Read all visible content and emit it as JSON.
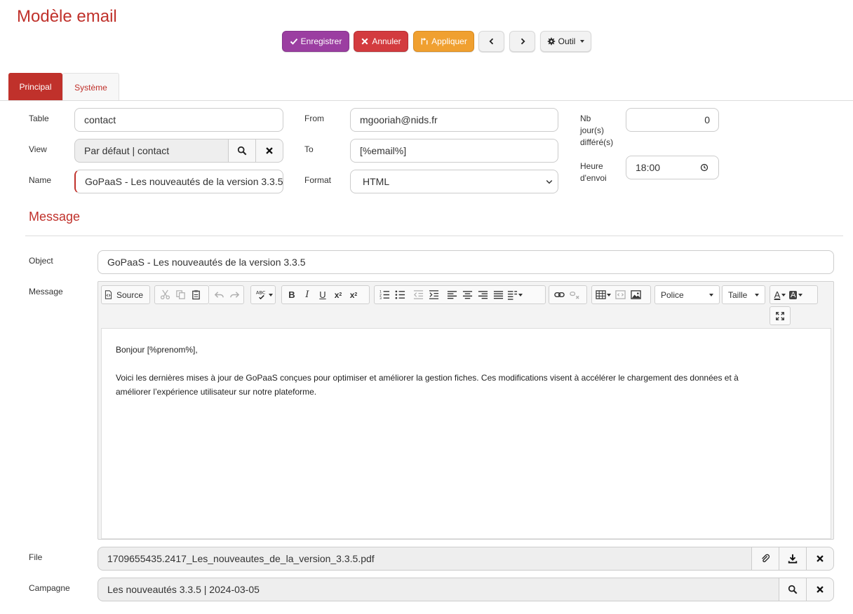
{
  "page": {
    "title": "Modèle email"
  },
  "toolbar": {
    "save_label": "Enregistrer",
    "cancel_label": "Annuler",
    "apply_label": "Appliquer",
    "tool_label": "Outil",
    "colors": {
      "save": "#9b3ea1",
      "cancel": "#d33b3f",
      "apply": "#f0a030"
    }
  },
  "tabs": [
    {
      "label": "Principal",
      "active": true
    },
    {
      "label": "Système",
      "active": false
    }
  ],
  "form": {
    "table": {
      "label": "Table",
      "value": "contact"
    },
    "view": {
      "label": "View",
      "value": "Par défaut | contact"
    },
    "name": {
      "label": "Name",
      "value": "GoPaaS - Les nouveautés de la version 3.3.5"
    },
    "from": {
      "label": "From",
      "value": "mgooriah@nids.fr"
    },
    "to": {
      "label": "To",
      "value": "[%email%]"
    },
    "format": {
      "label": "Format",
      "value": "HTML"
    },
    "nb_jours": {
      "label_line1": "Nb",
      "label_line2": "jour(s)",
      "label_line3": "différé(s)",
      "value": "0"
    },
    "heure": {
      "label_line1": "Heure",
      "label_line2": "d'envoi",
      "value": "18:00"
    }
  },
  "message_section": {
    "title": "Message",
    "object_label": "Object",
    "object_value": "GoPaaS - Les nouveautés de la version 3.3.5",
    "message_label": "Message",
    "editor": {
      "source_label": "Source",
      "font_label": "Police",
      "size_label": "Taille",
      "body_line1": "Bonjour [%prenom%],",
      "body_line2": "Voici les dernières mises à jour de GoPaaS conçues pour optimiser et améliorer la gestion fiches. Ces modifications visent à accélérer le chargement des données et à",
      "body_line3": "améliorer l’expérience utilisateur sur notre plateforme."
    }
  },
  "file": {
    "label": "File",
    "value": "1709655435.2417_Les_nouveautes_de_la_version_3.3.5.pdf"
  },
  "campagne": {
    "label": "Campagne",
    "value": "Les nouveautés 3.3.5 | 2024-03-05"
  }
}
